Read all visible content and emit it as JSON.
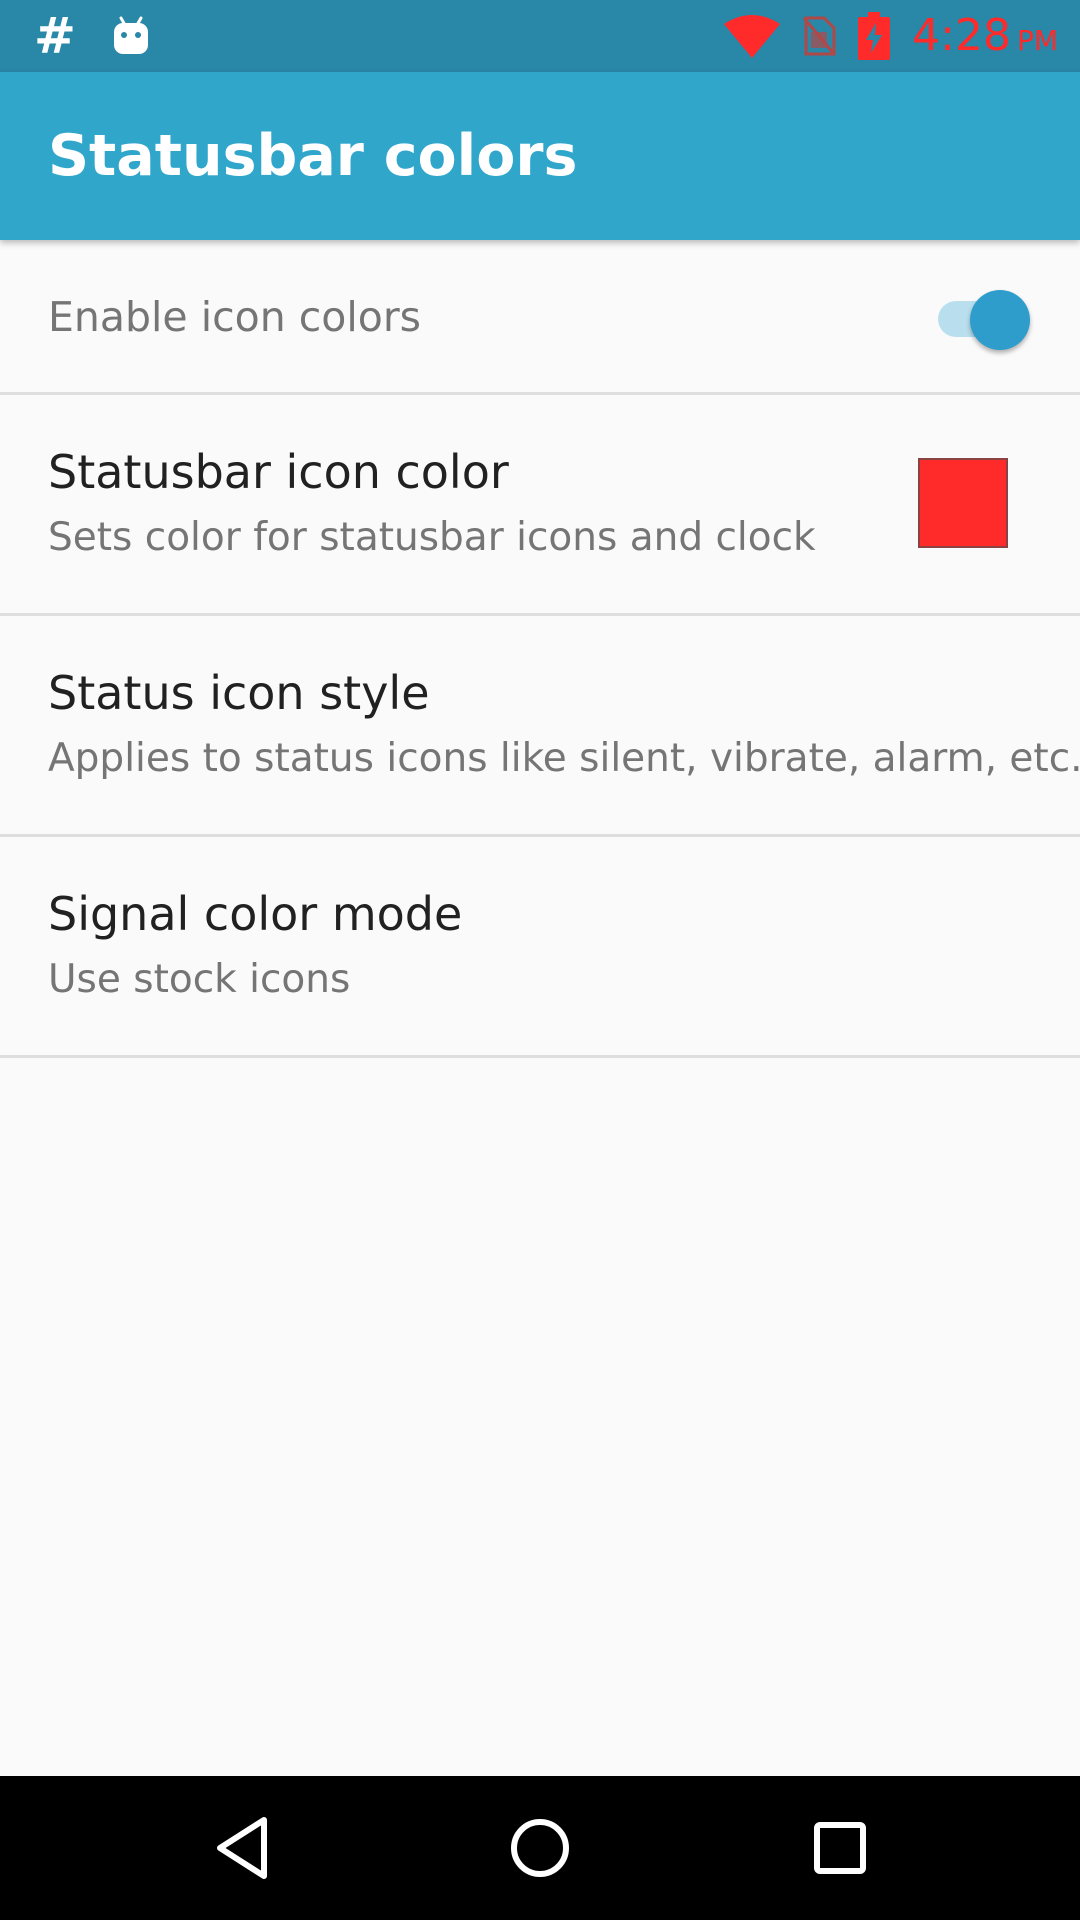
{
  "status_bar": {
    "left_icons": [
      "hash-icon",
      "android-head-icon"
    ],
    "right_icons": [
      "wifi-icon",
      "no-sim-icon",
      "battery-charging-icon"
    ],
    "hash_glyph": "#",
    "time": "4:28",
    "ampm": "PM",
    "icon_color": "#ff2a2a",
    "background": "#2987a7"
  },
  "app_bar": {
    "title": "Statusbar colors",
    "background": "#31a6cb"
  },
  "preferences": {
    "enable_icon_colors": {
      "title": "Enable icon colors",
      "enabled": true
    },
    "statusbar_icon_color": {
      "title": "Statusbar icon color",
      "summary": "Sets color for statusbar icons and clock",
      "color": "#ff2a2a"
    },
    "status_icon_style": {
      "title": "Status icon style",
      "summary": "Applies to status icons like silent, vibrate, alarm, etc."
    },
    "signal_color_mode": {
      "title": "Signal color mode",
      "summary": "Use stock icons"
    }
  },
  "nav_bar": {
    "buttons": [
      "back-icon",
      "home-icon",
      "recents-icon"
    ]
  }
}
